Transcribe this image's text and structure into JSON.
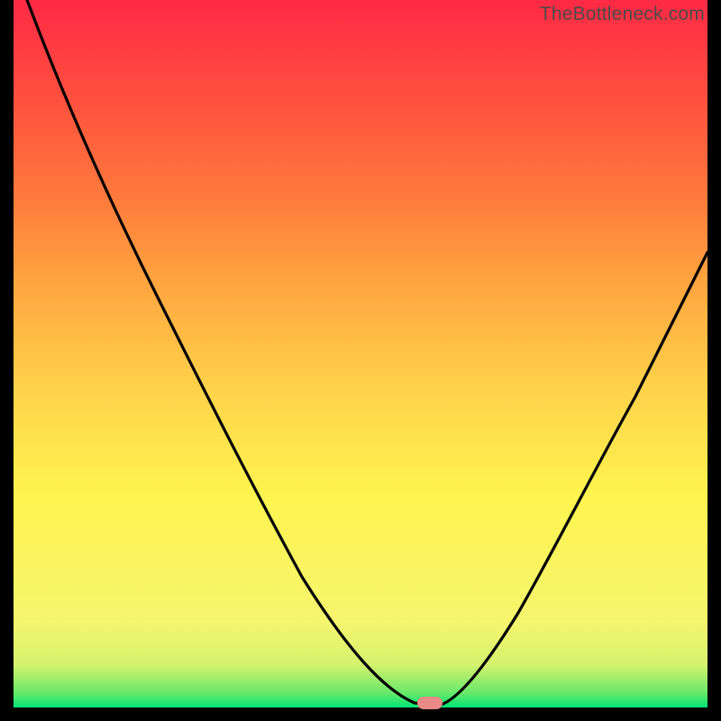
{
  "watermark": "TheBottleneck.com",
  "colors": {
    "frame_bg": "#000000",
    "gradient_top": "#ff2a45",
    "gradient_bottom": "#00e676",
    "curve_stroke": "#000000",
    "marker_fill": "#e98a87",
    "watermark_text": "#4a4a4a"
  },
  "chart_data": {
    "type": "line",
    "title": "",
    "xlabel": "",
    "ylabel": "",
    "x": [
      0.0,
      0.05,
      0.1,
      0.15,
      0.2,
      0.25,
      0.3,
      0.35,
      0.4,
      0.45,
      0.5,
      0.55,
      0.58,
      0.6,
      0.63,
      0.65,
      0.7,
      0.75,
      0.8,
      0.85,
      0.9,
      0.95,
      1.0
    ],
    "values": [
      100,
      93,
      85,
      77,
      69,
      60,
      51,
      42,
      33,
      24,
      15,
      6,
      1,
      0,
      1,
      4,
      12,
      21,
      30,
      39,
      48,
      56,
      63
    ],
    "xlim": [
      0,
      1
    ],
    "ylim": [
      0,
      100
    ],
    "minimum": {
      "x": 0.6,
      "y": 0
    },
    "marker": {
      "x": 0.6,
      "y": 0
    },
    "grid": false,
    "legend": false,
    "note": "V-shaped bottleneck curve; values estimated from vertical position against gradient (100 = top/red, 0 = bottom/green)."
  }
}
